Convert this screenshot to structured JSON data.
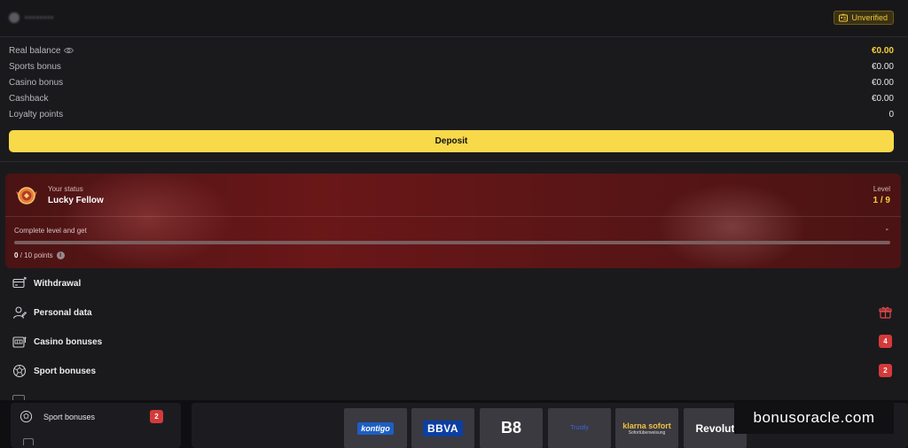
{
  "header": {
    "username": "••••••••",
    "verification_status": "Unverified"
  },
  "balances": [
    {
      "label": "Real balance",
      "value": "€0.00"
    },
    {
      "label": "Sports bonus",
      "value": "€0.00"
    },
    {
      "label": "Casino bonus",
      "value": "€0.00"
    },
    {
      "label": "Cashback",
      "value": "€0.00"
    },
    {
      "label": "Loyalty points",
      "value": "0"
    }
  ],
  "deposit_label": "Deposit",
  "status": {
    "label": "Your status",
    "name": "Lucky Fellow",
    "level_label": "Level",
    "level": "1 / 9",
    "complete_label": "Complete level and get",
    "reward": "-",
    "points_current": "0",
    "points_text": "/ 10 points",
    "progress_fraction": 0
  },
  "menu": [
    {
      "label": "Withdrawal",
      "icon": "withdrawal-card-icon"
    },
    {
      "label": "Personal data",
      "icon": "user-icon",
      "side_icon": "gift-icon"
    },
    {
      "label": "Casino bonuses",
      "icon": "slot-machine-icon",
      "badge": "4"
    },
    {
      "label": "Sport bonuses",
      "icon": "soccer-ball-icon",
      "badge": "2"
    }
  ],
  "side_panel": {
    "label": "Sport bonuses",
    "badge": "2"
  },
  "payment_methods": [
    "kontigo",
    "BBVA",
    "B8",
    "Trustly",
    "sofort",
    "Revolut"
  ],
  "payment_labels": {
    "kontigo": "kontigo",
    "bbva": "BBVA",
    "b8": "B8",
    "trustly": "Trustly",
    "sofort": "klarna sofort",
    "sofort_sub": "Sofortüberweisung",
    "revolut": "Revolut"
  },
  "watermark": "bonusoracle.com",
  "colors": {
    "accent": "#f7d94a",
    "badge": "#d43a3a",
    "background": "#1a1a1d",
    "status_banner": "#6a1718"
  }
}
